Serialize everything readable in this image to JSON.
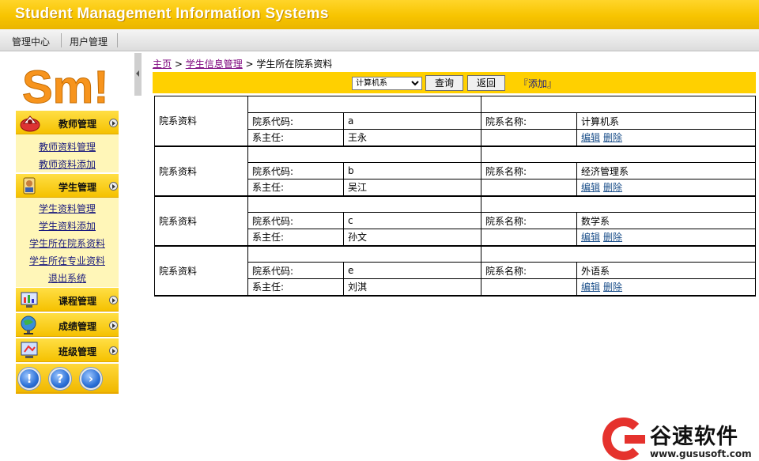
{
  "app": {
    "title": "Student Management Information Systems"
  },
  "topnav": [
    {
      "label": "管理中心"
    },
    {
      "label": "用户管理"
    }
  ],
  "sidebar": {
    "logo_text": "Sm!",
    "menus": [
      {
        "label": "教师管理",
        "icon": "teacher-icon",
        "items": [
          "教师资料管理",
          "教师资料添加"
        ]
      },
      {
        "label": "学生管理",
        "icon": "student-icon",
        "items": [
          "学生资料管理",
          "学生资料添加",
          "学生所在院系资料",
          "学生所在专业资料",
          "退出系统"
        ]
      },
      {
        "label": "课程管理",
        "icon": "course-icon",
        "items": []
      },
      {
        "label": "成绩管理",
        "icon": "grade-icon",
        "items": []
      },
      {
        "label": "班级管理",
        "icon": "class-icon",
        "items": []
      }
    ],
    "bottom_buttons": [
      {
        "icon": "info-icon",
        "glyph": "!"
      },
      {
        "icon": "help-icon",
        "glyph": "?"
      },
      {
        "icon": "next-icon",
        "glyph": "›"
      }
    ]
  },
  "breadcrumb": {
    "home": "主页",
    "sep1": " > ",
    "section": "学生信息管理",
    "sep2": " > ",
    "current": "学生所在院系资料"
  },
  "toolbar": {
    "select_value": "计算机系",
    "query_label": "查询",
    "back_label": "返回",
    "add_label": "『添加』"
  },
  "table": {
    "row_label": "院系资料",
    "code_label": "院系代码:",
    "name_label": "院系名称:",
    "head_label": "系主任:",
    "edit_label": "编辑",
    "delete_label": "删除",
    "records": [
      {
        "code": "a",
        "name": "计算机系",
        "head": "王永"
      },
      {
        "code": "b",
        "name": "经济管理系",
        "head": "吴江"
      },
      {
        "code": "c",
        "name": "数学系",
        "head": "孙文"
      },
      {
        "code": "e",
        "name": "外语系",
        "head": "刘淇"
      }
    ]
  },
  "watermark": {
    "name": "谷速软件",
    "url": "www.gususoft.com"
  },
  "colors": {
    "accent": "#ffd000",
    "header": "#f7c400",
    "submenu_bg": "#fff6b8",
    "link": "#1b4f8a",
    "brand_red": "#e5322d",
    "logo_orange": "#f7941d"
  }
}
